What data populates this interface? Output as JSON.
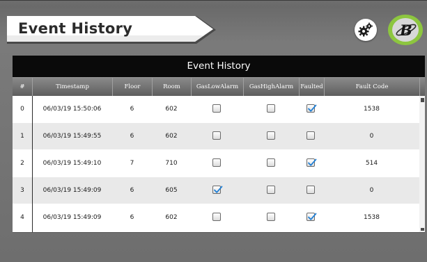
{
  "header": {
    "title": "Event History",
    "settings_icon": "gears-icon",
    "logo_icon": "brand-b-logo-icon",
    "colors": {
      "logo_ring": "#8dc63f",
      "banner": "#ffffff",
      "title_bar": "#0a0a0a"
    }
  },
  "table": {
    "title": "Event History",
    "columns": [
      "#",
      "Timestamp",
      "Floor",
      "Room",
      "GasLowAlarm",
      "GasHighAlarm",
      "Faulted",
      "Fault Code"
    ],
    "rows": [
      {
        "index": "0",
        "timestamp": "06/03/19 15:50:06",
        "floor": "6",
        "room": "602",
        "gas_low_alarm": false,
        "gas_high_alarm": false,
        "faulted": true,
        "fault_code": "1538"
      },
      {
        "index": "1",
        "timestamp": "06/03/19 15:49:55",
        "floor": "6",
        "room": "602",
        "gas_low_alarm": false,
        "gas_high_alarm": false,
        "faulted": false,
        "fault_code": "0"
      },
      {
        "index": "2",
        "timestamp": "06/03/19 15:49:10",
        "floor": "7",
        "room": "710",
        "gas_low_alarm": false,
        "gas_high_alarm": false,
        "faulted": true,
        "fault_code": "514"
      },
      {
        "index": "3",
        "timestamp": "06/03/19 15:49:09",
        "floor": "6",
        "room": "605",
        "gas_low_alarm": true,
        "gas_high_alarm": false,
        "faulted": false,
        "fault_code": "0"
      },
      {
        "index": "4",
        "timestamp": "06/03/19 15:49:09",
        "floor": "6",
        "room": "602",
        "gas_low_alarm": false,
        "gas_high_alarm": false,
        "faulted": true,
        "fault_code": "1538"
      }
    ]
  }
}
